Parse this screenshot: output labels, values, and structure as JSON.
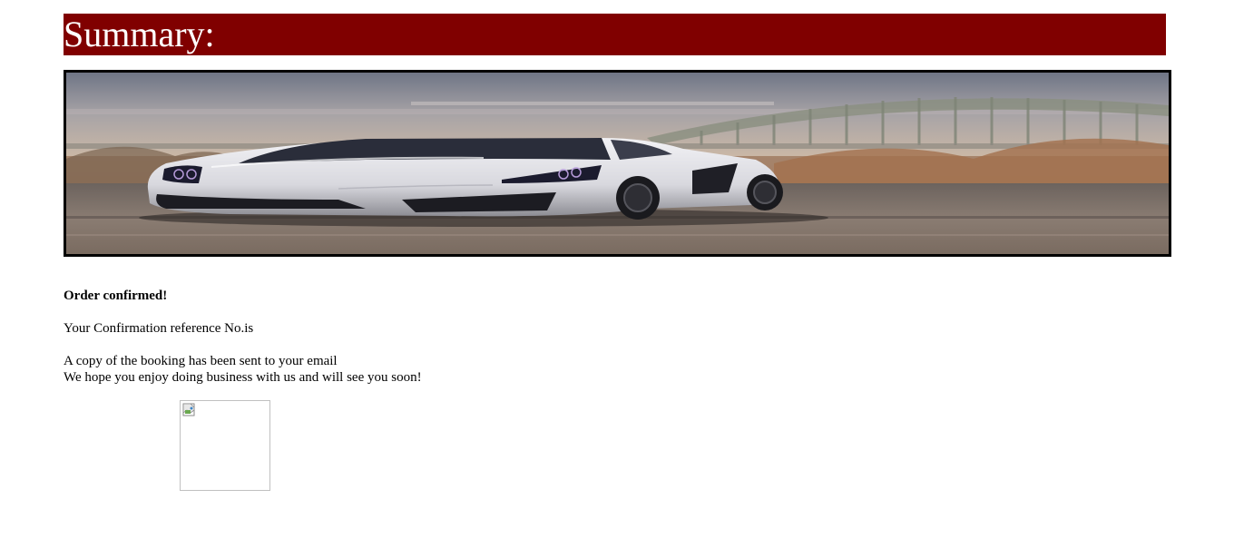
{
  "header": {
    "title": "Summary:",
    "background_color": "#800000",
    "title_color": "#ffffff"
  },
  "banner": {
    "image": "white-supercar-on-road-with-bridge-photo"
  },
  "order": {
    "heading": "Order confirmed!",
    "reference_text": "Your Confirmation reference No.is",
    "email_notice": "A copy of the booking has been sent to your email",
    "closing_text": "We hope you enjoy doing business with us and will see you soon!"
  },
  "image_placeholder": {
    "icon": "broken-image-icon"
  }
}
